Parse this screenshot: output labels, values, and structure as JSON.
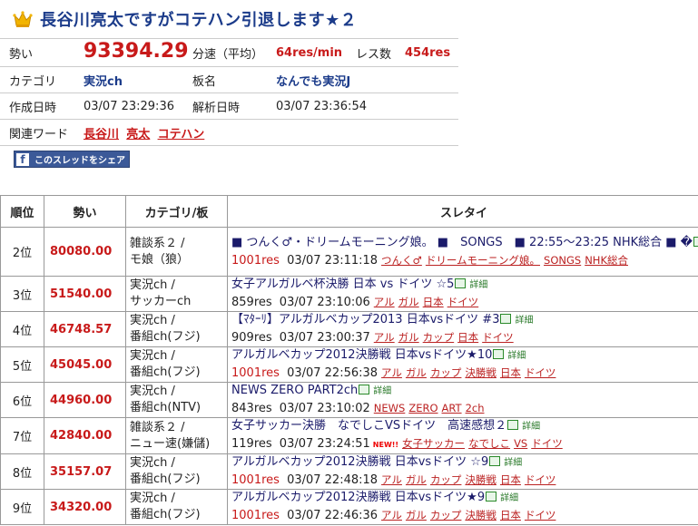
{
  "header": {
    "title": "長谷川亮太ですがコテハン引退します★２",
    "momentum_label": "勢い",
    "momentum_value": "93394.29",
    "speed_label": "分速（平均）",
    "speed_value": "64res/min",
    "res_count_label": "レス数",
    "res_count_value": "454res",
    "category_label": "カテゴリ",
    "category_value": "実況ch",
    "board_label": "板名",
    "board_value": "なんでも実況J",
    "created_label": "作成日時",
    "created_value": "03/07 23:29:36",
    "analyzed_label": "解析日時",
    "analyzed_value": "03/07 23:36:54",
    "related_label": "関連ワード",
    "related_words": [
      "長谷川",
      "亮太",
      "コテハン"
    ],
    "share_label": "このスレッドをシェア",
    "share_icon": "f"
  },
  "table": {
    "headers": [
      "順位",
      "勢い",
      "カテゴリ/板",
      "スレタイ"
    ],
    "detail_label": "詳細",
    "rows": [
      {
        "rank": "2位",
        "speed": "80080.00",
        "cat1": "雑談系２ /",
        "cat2": "モ娘（狼）",
        "title": "■ つんく♂・ドリームモーニング娘。 ■　SONGS　■ 22:55～23:25 NHK総合 ■ �",
        "res": "1001res",
        "res_red": true,
        "time": "03/07 23:11:18",
        "tags": [
          "つんく♂",
          "ドリームモーニング娘。",
          "SONGS",
          "NHK総合"
        ],
        "new": ""
      },
      {
        "rank": "3位",
        "speed": "51540.00",
        "cat1": "実況ch /",
        "cat2": "サッカーch",
        "title": "女子アルガルベ杯決勝 日本 vs ドイツ ☆5",
        "res": "859res",
        "res_red": false,
        "time": "03/07 23:10:06",
        "tags": [
          "アル",
          "ガル",
          "日本",
          "ドイツ"
        ],
        "new": ""
      },
      {
        "rank": "4位",
        "speed": "46748.57",
        "cat1": "実況ch /",
        "cat2": "番組ch(フジ)",
        "title": "【ﾏﾀｰﾘ】アルガルベカップ2013 日本vsドイツ #3",
        "res": "909res",
        "res_red": false,
        "time": "03/07 23:00:37",
        "tags": [
          "アル",
          "ガル",
          "カップ",
          "日本",
          "ドイツ"
        ],
        "new": ""
      },
      {
        "rank": "5位",
        "speed": "45045.00",
        "cat1": "実況ch /",
        "cat2": "番組ch(フジ)",
        "title": "アルガルベカップ2012決勝戦 日本vsドイツ★10",
        "res": "1001res",
        "res_red": true,
        "time": "03/07 22:56:38",
        "tags": [
          "アル",
          "ガル",
          "カップ",
          "決勝戦",
          "日本",
          "ドイツ"
        ],
        "new": ""
      },
      {
        "rank": "6位",
        "speed": "44960.00",
        "cat1": "実況ch /",
        "cat2": "番組ch(NTV)",
        "title": "NEWS ZERO PART2ch",
        "res": "843res",
        "res_red": false,
        "time": "03/07 23:10:02",
        "tags": [
          "NEWS",
          "ZERO",
          "ART",
          "2ch"
        ],
        "new": ""
      },
      {
        "rank": "7位",
        "speed": "42840.00",
        "cat1": "雑談系２ /",
        "cat2": "ニュー速(嫌儲)",
        "title": "女子サッカー決勝　なでしこVSドイツ　高速感想２",
        "res": "119res",
        "res_red": false,
        "time": "03/07 23:24:51",
        "tags": [
          "女子サッカー",
          "なでしこ",
          "VS",
          "ドイツ"
        ],
        "new": "NEW!!"
      },
      {
        "rank": "8位",
        "speed": "35157.07",
        "cat1": "実況ch /",
        "cat2": "番組ch(フジ)",
        "title": "アルガルベカップ2012決勝戦 日本vsドイツ ☆9",
        "res": "1001res",
        "res_red": true,
        "time": "03/07 22:48:18",
        "tags": [
          "アル",
          "ガル",
          "カップ",
          "決勝戦",
          "日本",
          "ドイツ"
        ],
        "new": ""
      },
      {
        "rank": "9位",
        "speed": "34320.00",
        "cat1": "実況ch /",
        "cat2": "番組ch(フジ)",
        "title": "アルガルベカップ2012決勝戦 日本vsドイツ★9",
        "res": "1001res",
        "res_red": true,
        "time": "03/07 22:46:36",
        "tags": [
          "アル",
          "ガル",
          "カップ",
          "決勝戦",
          "日本",
          "ドイツ"
        ],
        "new": ""
      }
    ]
  },
  "colors": {
    "title": "#1b3b8a",
    "accent_red": "#c81a1a",
    "link": "#b22222",
    "facebook": "#3b5998"
  }
}
